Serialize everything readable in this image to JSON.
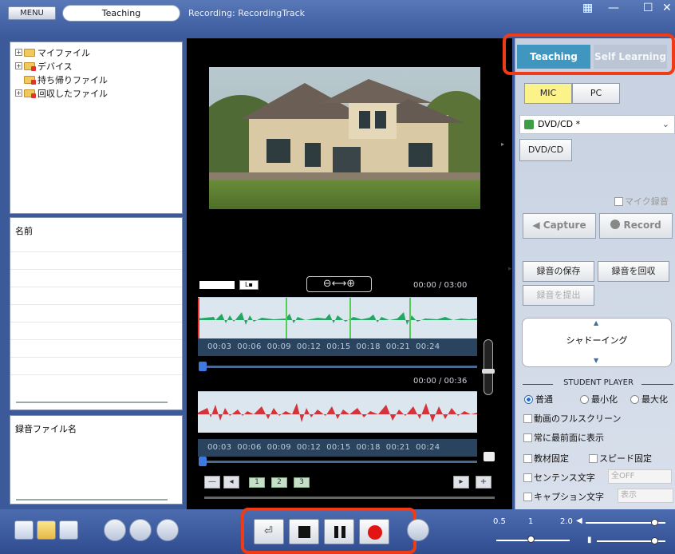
{
  "header": {
    "menu_label": "MENU",
    "mode": "Teaching",
    "recording_title": "Recording: RecordingTrack"
  },
  "tree": [
    {
      "label": "マイファイル",
      "expandable": true
    },
    {
      "label": "デバイス",
      "expandable": true
    },
    {
      "label": "持ち帰りファイル",
      "expandable": false
    },
    {
      "label": "回収したファイル",
      "expandable": true
    }
  ],
  "names_panel": {
    "header": "名前"
  },
  "recfiles_panel": {
    "header": "録音ファイル名"
  },
  "player": {
    "time_top": "00:00 / 03:00",
    "time_bottom": "00:00 / 00:36",
    "ticks": [
      "00:03",
      "00:06",
      "00:09",
      "00:12",
      "00:15",
      "00:18",
      "00:21",
      "00:24"
    ],
    "pages": [
      "1",
      "2",
      "3"
    ]
  },
  "tabs": {
    "teaching": "Teaching",
    "self_learning": "Self Learning"
  },
  "source": {
    "mic": "MIC",
    "pc": "PC"
  },
  "dvd": {
    "selected": "DVD/CD *",
    "button": "DVD/CD"
  },
  "mic_record_label": "マイク録音",
  "actions": {
    "capture": "Capture",
    "record": "Record",
    "save": "録音の保存",
    "collect": "録音を回収",
    "submit": "録音を提出",
    "shadowing": "シャドーイング"
  },
  "student_player": {
    "title": "STUDENT PLAYER",
    "modes": [
      "普通",
      "最小化",
      "最大化"
    ],
    "options": {
      "fullscreen": "動画のフルスクリーン",
      "front": "常に最前面に表示",
      "material_fixed": "教材固定",
      "speed_fixed": "スピード固定",
      "sentence": "センテンス文字",
      "sentence_value": "全OFF",
      "caption": "キャプション文字",
      "caption_value": "表示"
    }
  },
  "speed": {
    "min": "0.5",
    "mid": "1",
    "max": "2.0"
  }
}
